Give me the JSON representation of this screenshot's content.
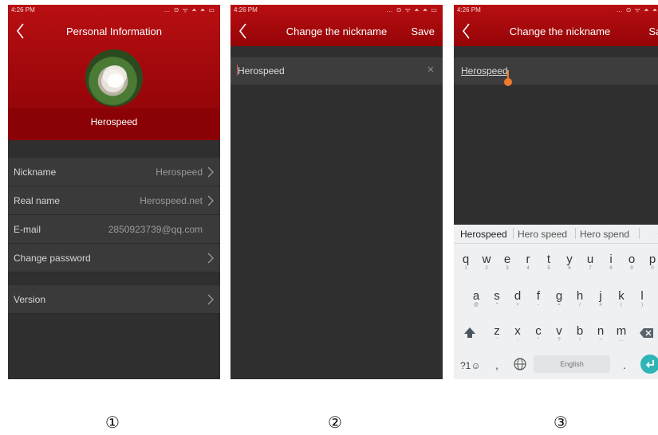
{
  "panels": [
    {
      "status_time": "4:26 PM",
      "title": "Personal Information",
      "username": "Herospeed",
      "rows": [
        {
          "label": "Nickname",
          "value": "Herospeed"
        },
        {
          "label": "Real name",
          "value": "Herospeed.net"
        },
        {
          "label": "E-mail",
          "value": "2850923739@qq.com"
        },
        {
          "label": "Change password",
          "value": ""
        },
        {
          "label": "Version",
          "value": ""
        }
      ],
      "caption": "①"
    },
    {
      "status_time": "4:26 PM",
      "title": "Change the nickname",
      "save_label": "Save",
      "input_value": "Herospeed",
      "caption": "②"
    },
    {
      "status_time": "4:26 PM",
      "title": "Change the nickname",
      "save_label": "Save",
      "input_value": "Herospeed",
      "caption": "③",
      "suggestions": [
        "Herospeed",
        "Hero speed",
        "Hero spend"
      ],
      "keyboard": {
        "row1": [
          [
            "q",
            "1"
          ],
          [
            "w",
            "2"
          ],
          [
            "e",
            "3"
          ],
          [
            "r",
            "4"
          ],
          [
            "t",
            "5"
          ],
          [
            "y",
            "6"
          ],
          [
            "u",
            "7"
          ],
          [
            "i",
            "8"
          ],
          [
            "o",
            "9"
          ],
          [
            "p",
            "0"
          ]
        ],
        "row2": [
          [
            "a",
            "@"
          ],
          [
            "s",
            "*"
          ],
          [
            "d",
            "+"
          ],
          [
            "f",
            "-"
          ],
          [
            "g",
            "="
          ],
          [
            "h",
            "/"
          ],
          [
            "j",
            "#"
          ],
          [
            "k",
            "("
          ],
          [
            "l",
            ")"
          ]
        ],
        "row3": [
          [
            "z",
            "'"
          ],
          [
            "x",
            ":"
          ],
          [
            "c",
            "\""
          ],
          [
            "v",
            "?"
          ],
          [
            "b",
            "!"
          ],
          [
            "n",
            "~"
          ],
          [
            "m",
            "…"
          ]
        ],
        "sym_label": "?1☺",
        "comma_label": ",",
        "space_label": "English",
        "period_label": "."
      }
    }
  ],
  "status_icons": "… ⊙ ᯤ ⏶ ⏶ ▭",
  "colors": {
    "header_red": "#b80f12",
    "dark_bg": "#2f2f2f",
    "row_bg": "#3a3a3a",
    "accent_teal": "#2fb5b7",
    "handle_orange": "#f07b2a"
  }
}
